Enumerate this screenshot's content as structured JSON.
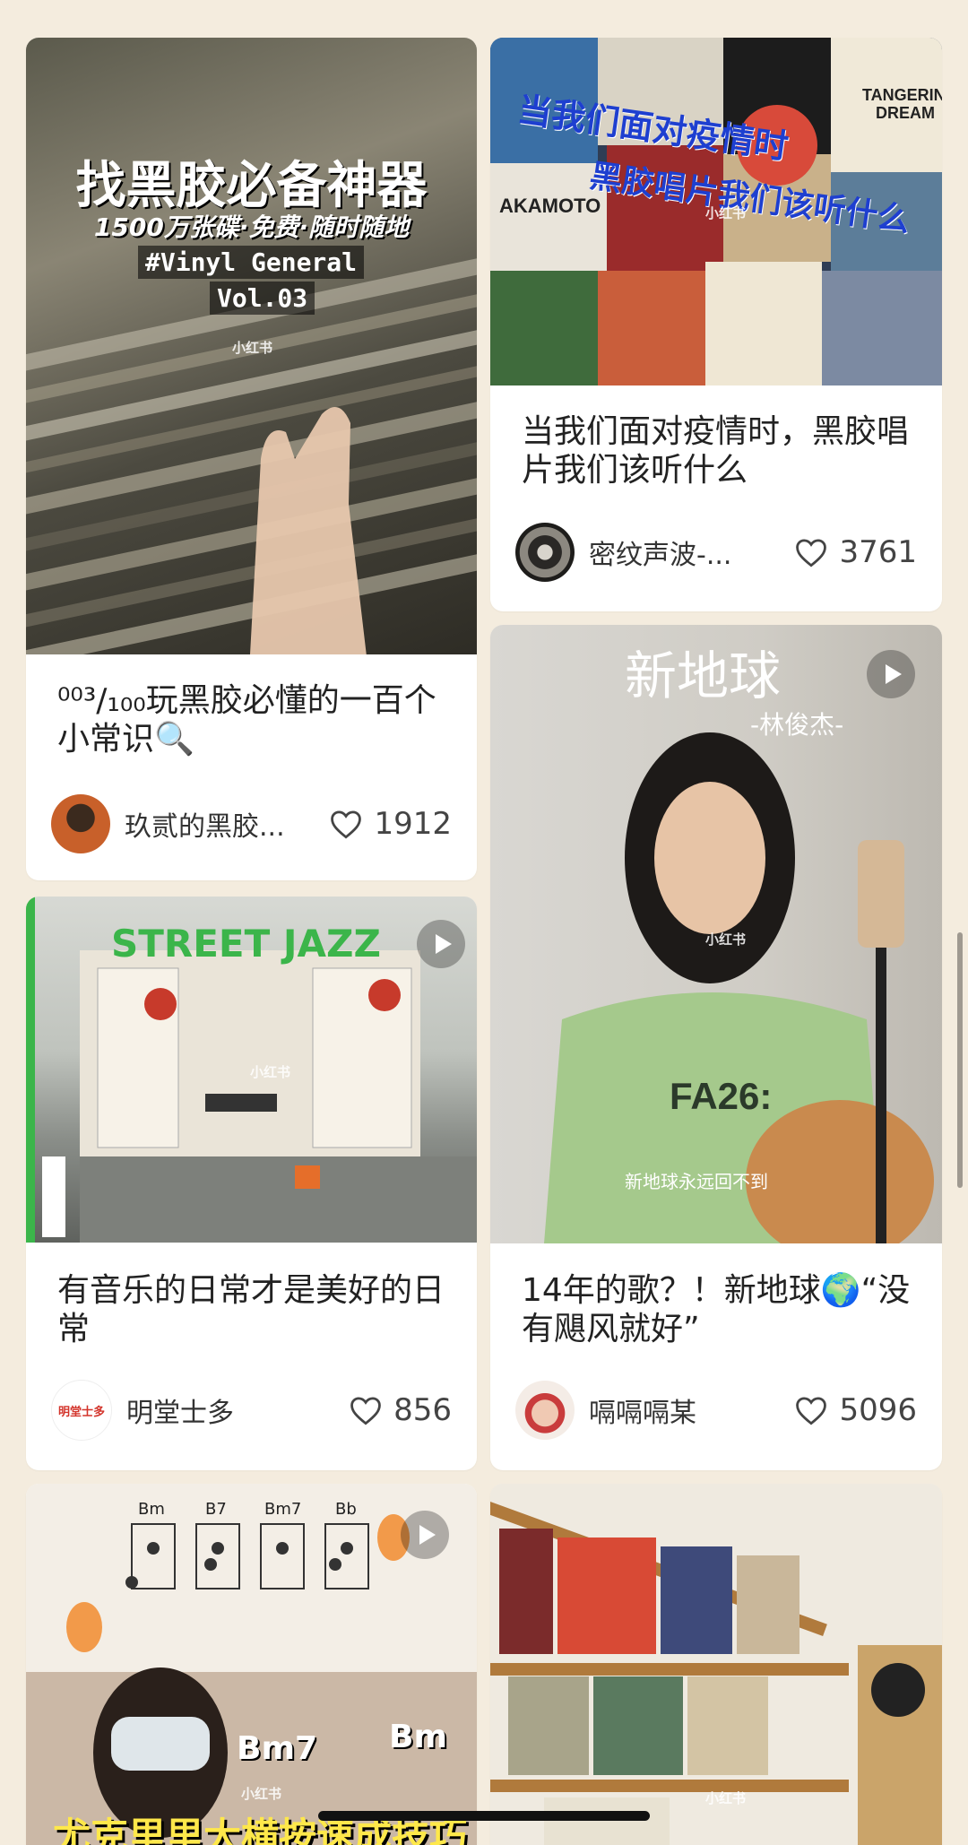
{
  "feed": {
    "cards": [
      {
        "title": "⁰⁰³/₁₀₀玩黑胶必懂的一百个小常识🔍",
        "author": "玖贰的黑胶...",
        "likes": "1912",
        "cover_text": {
          "headline": "找黑胶必备神器",
          "subline": "1500万张碟·免费·随时随地",
          "tag": "#Vinyl General",
          "vol": "Vol.03",
          "watermark": "小红书"
        }
      },
      {
        "title": "当我们面对疫情时，黑胶唱片我们该听什么",
        "author": "密纹声波-...",
        "likes": "3761",
        "cover_text": {
          "headline_1": "当我们面对疫情时",
          "headline_2": "黑胶唱片我们该听什么",
          "watermark": "小红书"
        }
      },
      {
        "title": "有音乐的日常才是美好的日常",
        "author": "明堂士多",
        "likes": "856",
        "cover_text": {
          "headline": "STREET JAZZ",
          "watermark": "小红书"
        }
      },
      {
        "title": "14年的歌？！新地球🌍“没有飓风就好”",
        "author": "嗝嗝嗝某",
        "likes": "5096",
        "cover_text": {
          "headline": "新地球",
          "subline": "-林俊杰-",
          "caption": "新地球永远回不到",
          "watermark": "小红书"
        }
      },
      {
        "cover_text": {
          "chords": [
            "Bm",
            "B7",
            "Bm7",
            "Bb"
          ],
          "chord_label_1": "Bm7",
          "chord_label_2": "Bm",
          "headline": "尤克里里大横按速成技巧",
          "watermark": "小红书"
        }
      },
      {
        "cover_text": {
          "watermark": "小红书"
        }
      }
    ]
  },
  "colors": {
    "background": "#f4ecde",
    "card": "#ffffff",
    "text": "#222222",
    "street_jazz_green": "#3bb54a"
  }
}
